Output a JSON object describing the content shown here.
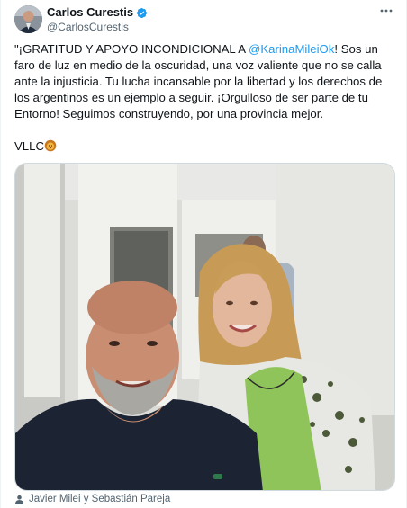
{
  "author": {
    "display_name": "Carlos Curestis",
    "handle": "@CarlosCurestis",
    "verified": true
  },
  "tweet": {
    "text_before_mention": "\"¡GRATITUD Y APOYO INCONDICIONAL A ",
    "mention": "@KarinaMileiOk",
    "text_after_mention": "! Sos un faro de luz en medio de la oscuridad, una voz valiente que no se calla ante la injusticia. Tu lucha incansable por la libertad y los derechos de los argentinos es un ejemplo a seguir. ¡Orgulloso de ser parte de tu Entorno! Seguimos construyendo, por una provincia mejor.",
    "signature": "VLLC"
  },
  "media": {
    "tagged_people": "Javier Milei y Sebastián Pareja"
  },
  "colors": {
    "link": "#1d9bf0",
    "muted": "#536471",
    "verified": "#1d9bf0"
  },
  "icons": {
    "verified": "verified-badge-icon",
    "more": "more-options-icon",
    "tag": "person-tag-icon",
    "lion": "lion-emoji"
  }
}
